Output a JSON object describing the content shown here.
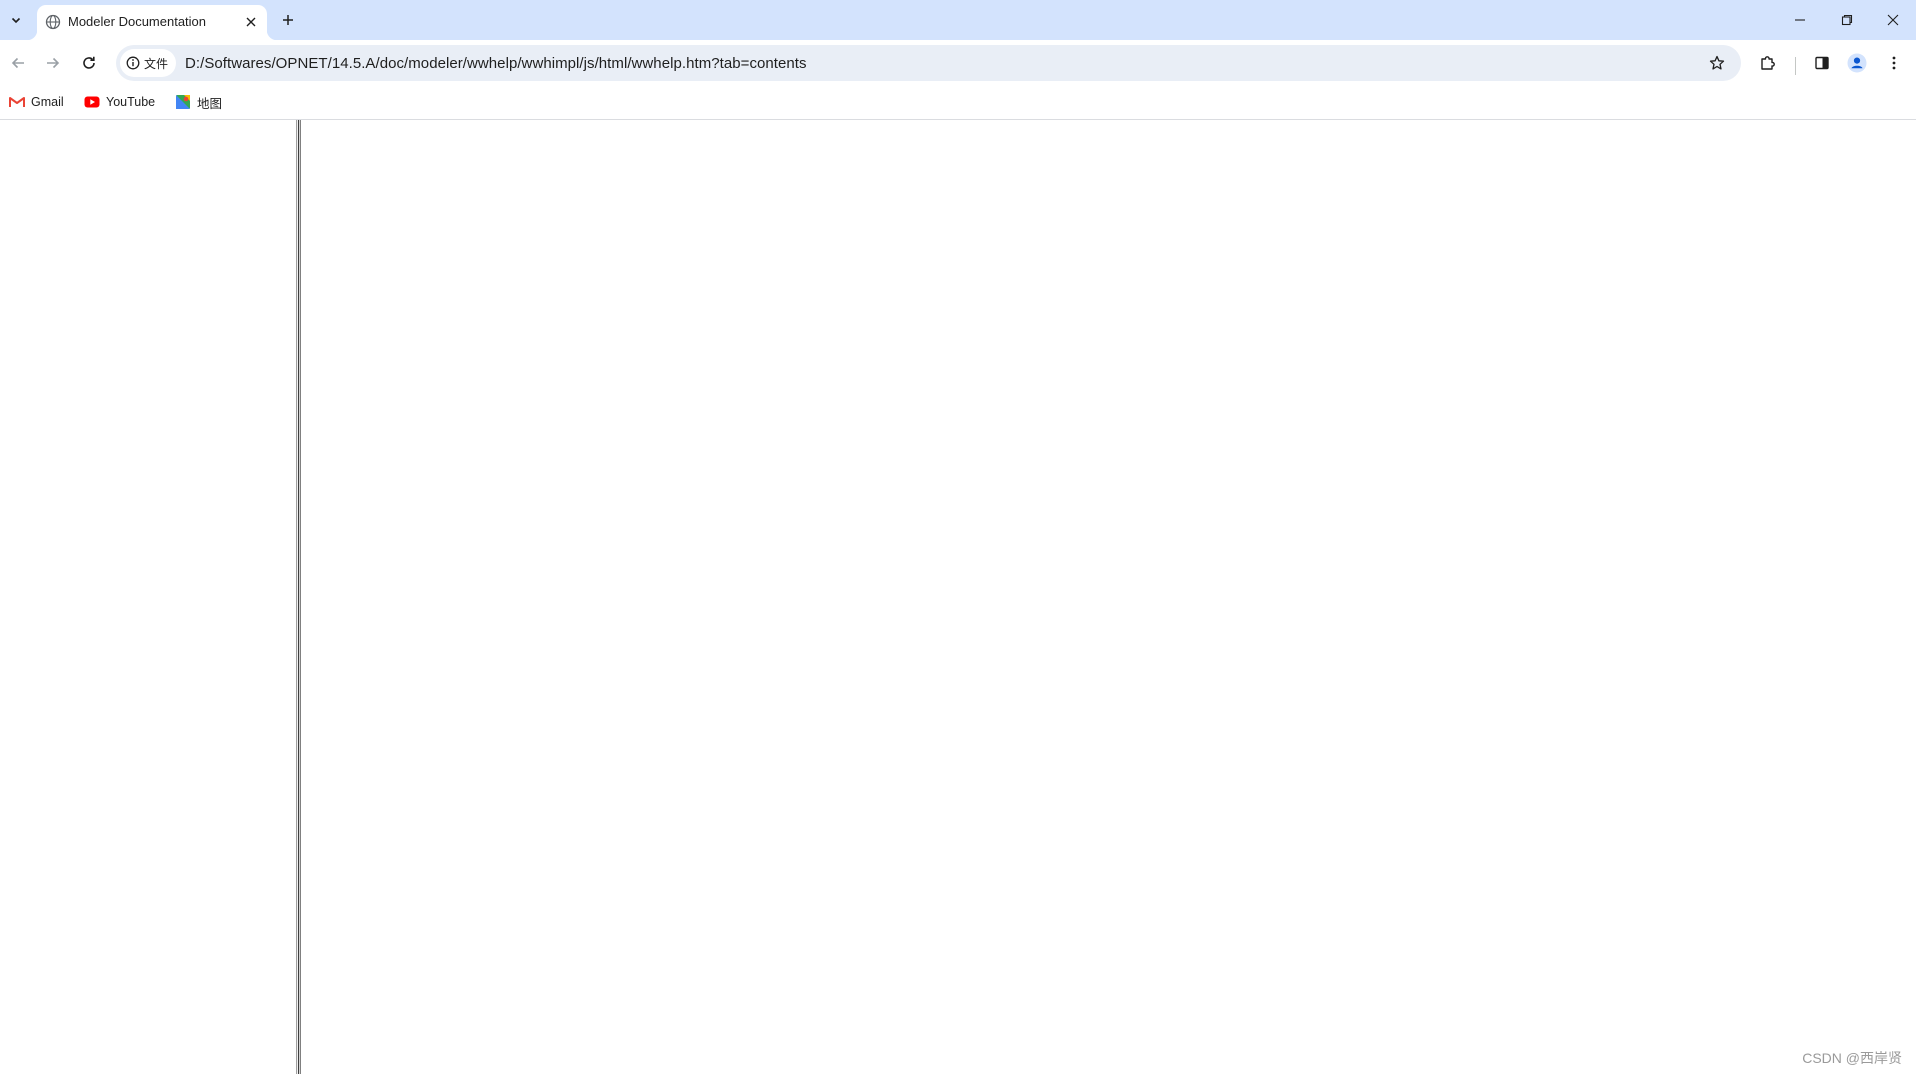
{
  "browser": {
    "tab": {
      "title": "Modeler Documentation",
      "favicon": "globe-icon"
    },
    "address_bar": {
      "security_chip_label": "文件",
      "security_icon": "info-icon",
      "url": "D:/Softwares/OPNET/14.5.A/doc/modeler/wwhelp/wwhimpl/js/html/wwhelp.htm?tab=contents"
    },
    "bookmarks": [
      {
        "label": "Gmail",
        "icon": "gmail-icon"
      },
      {
        "label": "YouTube",
        "icon": "youtube-icon"
      },
      {
        "label": "地图",
        "icon": "maps-icon"
      }
    ],
    "colors": {
      "tabstrip_bg": "#d3e3fd",
      "omnibox_bg": "#e9eef6",
      "profile_accent": "#0b57d0"
    }
  },
  "page": {
    "watermark": "CSDN @西岸贤"
  }
}
